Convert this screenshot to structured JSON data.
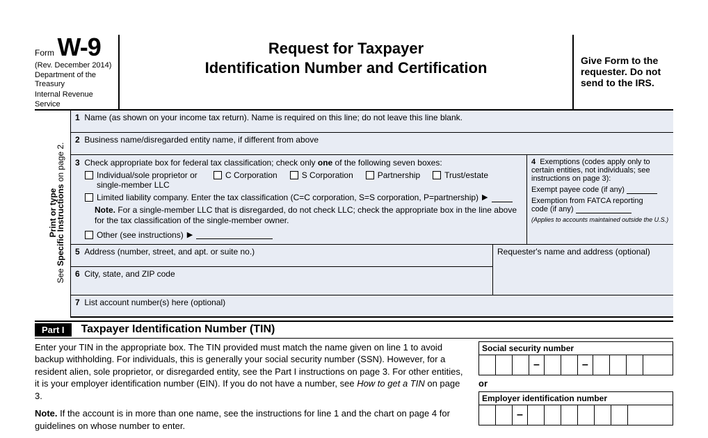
{
  "header": {
    "form_word": "Form",
    "form_number": "W-9",
    "revision": "(Rev. December 2014)",
    "dept_line1": "Department of the Treasury",
    "dept_line2": "Internal Revenue Service",
    "title_line1": "Request for Taxpayer",
    "title_line2": "Identification Number and Certification",
    "right_text": "Give Form to the requester. Do not send to the IRS."
  },
  "sidebar": {
    "bold": "Print or type",
    "plain": "See Specific Instructions on page 2."
  },
  "lines": {
    "l1": "Name (as shown on your income tax return). Name is required on this line; do not leave this line blank.",
    "l2": "Business name/disregarded entity name, if different from above",
    "l3_lead": "Check appropriate box for federal tax classification; check only ",
    "l3_one": "one",
    "l3_tail": " of the following seven boxes:",
    "chk_individual": "Individual/sole proprietor or single-member LLC",
    "chk_ccorp": "C Corporation",
    "chk_scorp": "S Corporation",
    "chk_partnership": "Partnership",
    "chk_trust": "Trust/estate",
    "chk_llc": "Limited liability company. Enter the tax classification (C=C corporation, S=S corporation, P=partnership) ",
    "note_label": "Note.",
    "note_text": " For a single-member LLC that is disregarded, do not check LLC; check the appropriate box in the line above for the tax classification of the single-member owner.",
    "chk_other": "Other (see instructions) ",
    "l4_lead": "Exemptions (codes apply only to certain entities, not individuals; see instructions on page 3):",
    "l4_exempt_payee": "Exempt payee code (if any)",
    "l4_fatca_line1": "Exemption from FATCA reporting",
    "l4_fatca_line2": "code (if any)",
    "l4_applies": "(Applies to accounts maintained outside the U.S.)",
    "l5": "Address (number, street, and apt. or suite no.)",
    "l5_right": "Requester's name and address (optional)",
    "l6": "City, state, and ZIP code",
    "l7": "List account number(s) here (optional)"
  },
  "part1": {
    "badge": "Part I",
    "title": "Taxpayer Identification Number (TIN)",
    "para1_a": "Enter your TIN in the appropriate box. The TIN provided must match the name given on line 1 to avoid backup withholding. For individuals, this is generally your social security number (SSN). However, for a resident alien, sole proprietor, or disregarded entity, see the Part I instructions on page 3. For other entities, it is your employer identification number (EIN). If you do not have a number, see ",
    "para1_italic": "How to get a TIN",
    "para1_b": " on page 3.",
    "note_label": "Note.",
    "para2": " If the account is in more than one name, see the instructions for line 1 and the chart on page 4 for guidelines on whose number to enter.",
    "ssn_label": "Social security number",
    "or": "or",
    "ein_label": "Employer identification number"
  },
  "nums": {
    "n1": "1",
    "n2": "2",
    "n3": "3",
    "n4": "4",
    "n5": "5",
    "n6": "6",
    "n7": "7"
  },
  "glyphs": {
    "tri": "▶",
    "dash": "–"
  }
}
